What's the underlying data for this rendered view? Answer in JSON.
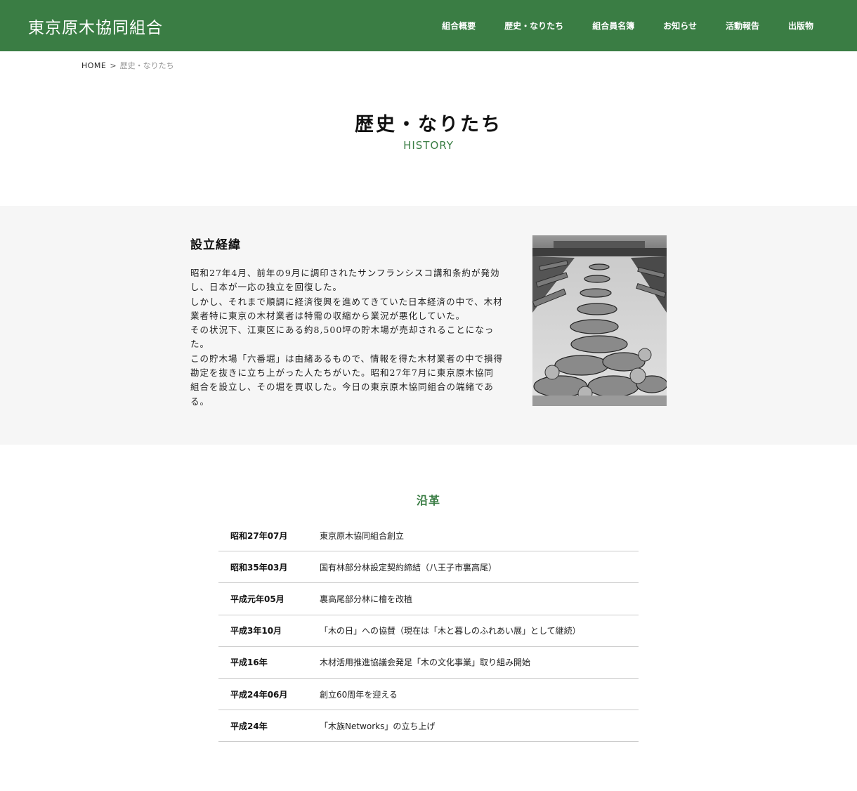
{
  "header": {
    "logo": "東京原木協同組合",
    "nav": [
      {
        "label": "組合概要"
      },
      {
        "label": "歴史・なりたち"
      },
      {
        "label": "組合員名簿"
      },
      {
        "label": "お知らせ"
      },
      {
        "label": "活動報告"
      },
      {
        "label": "出版物"
      }
    ],
    "background_color": "#3a7d44"
  },
  "breadcrumb": {
    "home": "HOME",
    "separator": ">",
    "current": "歴史・なりたち"
  },
  "page": {
    "title": "歴史・なりたち",
    "subtitle": "HISTORY"
  },
  "intro": {
    "heading": "設立経緯",
    "paragraphs": [
      "昭和27年4月、前年の9月に調印されたサンフランシスコ講和条約が発効し、日本が一応の独立を回復した。",
      "しかし、それまで順調に経済復興を進めてきていた日本経済の中で、木材業者特に東京の木材業者は特需の収縮から業況が悪化していた。",
      "その状況下、江東区にある約8,500坪の貯木場が売却されることになった。",
      "この貯木場「六番堀」は由緒あるもので、情報を得た木材業者の中で損得勘定を抜きに立ち上がった人たちがいた。昭和27年7月に東京原木協同組合を設立し、その堀を買収した。今日の東京原木協同組合の端緒である。"
    ],
    "photo_icon": "timber-pond-photo"
  },
  "timeline": {
    "title": "沿革",
    "items": [
      {
        "date": "昭和27年07月",
        "event": "東京原木協同組合創立"
      },
      {
        "date": "昭和35年03月",
        "event": "国有林部分林設定契約締結（八王子市裏高尾）"
      },
      {
        "date": "平成元年05月",
        "event": "裏高尾部分林に檜を改植"
      },
      {
        "date": "平成3年10月",
        "event": "「木の日」への協賛（現在は「木と暮しのふれあい展」として継続）"
      },
      {
        "date": "平成16年",
        "event": "木材活用推進協議会発足「木の文化事業」取り組み開始"
      },
      {
        "date": "平成24年06月",
        "event": "創立60周年を迎える"
      },
      {
        "date": "平成24年",
        "event": "「木族Networks」の立ち上げ"
      }
    ]
  }
}
